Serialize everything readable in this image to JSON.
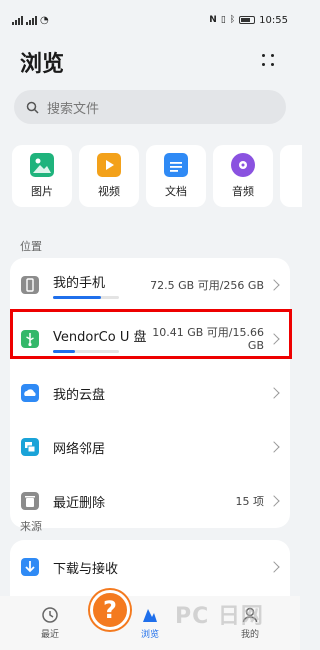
{
  "status": {
    "time": "10:55"
  },
  "header": {
    "title": "浏览"
  },
  "search": {
    "placeholder": "搜索文件"
  },
  "categories": [
    {
      "label": "图片",
      "icon": "image-icon",
      "color": "#1fb37c"
    },
    {
      "label": "视频",
      "icon": "video-icon",
      "color": "#f3a11a"
    },
    {
      "label": "文档",
      "icon": "document-icon",
      "color": "#2f8af5"
    },
    {
      "label": "音频",
      "icon": "audio-icon",
      "color": "#8a52e0"
    }
  ],
  "locations": {
    "title": "位置",
    "items": [
      {
        "name": "我的手机",
        "meta": "72.5 GB 可用/256 GB",
        "icon": "phone-icon",
        "usage_fraction": 0.72
      },
      {
        "name": "VendorCo U 盘",
        "meta_line1": "10.41 GB 可用/15.66",
        "meta_line2": "GB",
        "icon": "usb-icon",
        "usage_fraction": 0.34
      },
      {
        "name": "我的云盘",
        "icon": "cloud-drive-icon"
      },
      {
        "name": "网络邻居",
        "icon": "network-icon"
      },
      {
        "name": "最近删除",
        "meta": "15 项",
        "icon": "trash-icon"
      }
    ]
  },
  "sources": {
    "title": "来源",
    "items": [
      {
        "name": "下载与接收",
        "icon": "download-icon"
      }
    ]
  },
  "tabs": [
    {
      "label": "最近",
      "icon": "recent-icon",
      "active": false
    },
    {
      "label": "浏览",
      "icon": "browse-icon",
      "active": true
    },
    {
      "label": "我的",
      "icon": "profile-icon",
      "active": false
    }
  ],
  "overlay": {
    "help_symbol": "?",
    "watermark": "PC 日网"
  },
  "colors": {
    "accent": "#1f6feb",
    "highlight": "#e00000",
    "help": "#f47a1f"
  }
}
